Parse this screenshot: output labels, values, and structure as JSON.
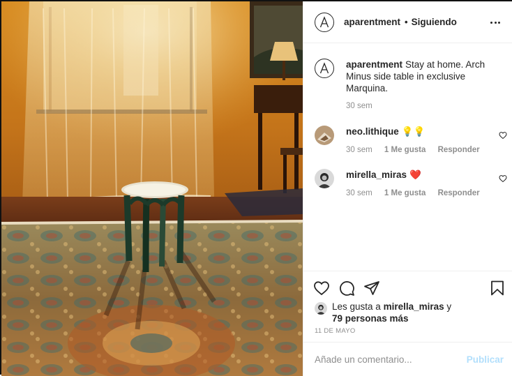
{
  "header": {
    "username": "aparentment",
    "separator": "•",
    "follow_status": "Siguiendo",
    "logo_letter": "A"
  },
  "caption": {
    "username": "aparentment",
    "text": "Stay at home. Arch Minus side table in exclusive Marquina.",
    "time": "30 sem"
  },
  "comments": [
    {
      "username": "neo.lithique",
      "text": "💡💡",
      "time": "30 sem",
      "likes": "1 Me gusta",
      "reply": "Responder"
    },
    {
      "username": "mirella_miras",
      "text": "❤️",
      "time": "30 sem",
      "likes": "1 Me gusta",
      "reply": "Responder"
    }
  ],
  "likes": {
    "prefix": "Les gusta a",
    "user": "mirella_miras",
    "suffix": "y",
    "others": "79 personas más"
  },
  "date": "11 DE MAYO",
  "add_comment": {
    "placeholder": "Añade un comentario...",
    "publish_label": "Publicar"
  },
  "colors": {
    "text": "#262626",
    "secondary": "#8e8e8e",
    "publish_disabled": "#b2dffc",
    "heart_red": "#ed4956"
  }
}
